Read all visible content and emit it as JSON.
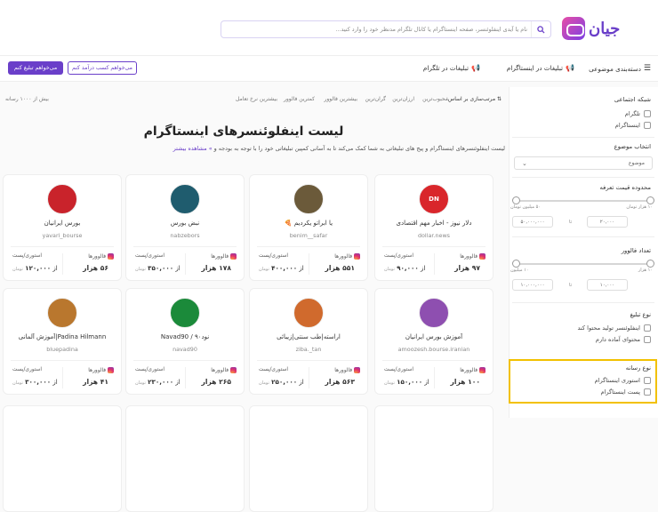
{
  "header": {
    "search_placeholder": "نام یا آیدی اینفلوئنسر، صفحه اینستاگرام یا کانال تلگرام مدنظر خود را وارد کنید...",
    "logo_text": "جیان"
  },
  "nav": {
    "categories": "دسته‌بندی موضوعی",
    "instagram_ads": "تبلیغات در اینستاگرام",
    "telegram_ads": "تبلیغات در تلگرام",
    "btn_advertise": "می‌خواهم تبلیغ کنم",
    "btn_earn": "می‌خواهم کسب درآمد کنم"
  },
  "sort": {
    "label": "مرتب‌سازی بر اساس:",
    "options": [
      "محبوب‌ترین",
      "ارزان‌ترین",
      "گران‌ترین",
      "بیشترین فالوور",
      "کمترین فالوور",
      "بیشترین نرخ تعامل"
    ],
    "count": "بیش از ۱۰۰۰ رسانه"
  },
  "page": {
    "title": "لیست اینفلوئنسرهای اینستاگرام",
    "desc": "لیست اینفلوئنسرهای اینستاگرام و پیج های تبلیغاتی به شما کمک می‌کند تا به آسانی کمپین تبلیغاتی خود را با توجه به بودجه و",
    "more": "» مشاهده بیشتر"
  },
  "sidebar": {
    "network_title": "شبکه اجتماعی",
    "networks": [
      "تلگرام",
      "اینستاگرام"
    ],
    "topic_title": "انتخاب موضوع",
    "topic_select": "موضوع",
    "price_title": "محدوده قیمت تعرفه",
    "price_min_lbl": "۱۰ هزار تومان",
    "price_max_lbl": "۵۰ میلیون تومان",
    "price_from": "۲۰,۰۰۰",
    "price_to": "۵۰,۰۰۰,۰۰۰",
    "to_word": "تا",
    "followers_title": "تعداد فالوور",
    "fol_min_lbl": "۱۰ هزار",
    "fol_max_lbl": "۱۰ میلیون",
    "fol_from": "۱۰,۰۰۰",
    "fol_to": "۱۰,۰۰۰,۰۰۰",
    "ad_type_title": "نوع تبلیغ",
    "ad_types": [
      "اینفلوئنسر تولید محتوا کند",
      "محتوای آماده دارم"
    ],
    "media_title": "نوع رسانه",
    "media_types": [
      "استوری اینستاگرام",
      "پست اینستاگرام"
    ]
  },
  "labels": {
    "followers": "فالوورها",
    "story_post": "استوری/پست",
    "from": "از",
    "toman": "تومان"
  },
  "cards": [
    {
      "name": "دلار نیوز - اخبار مهم اقتصادی",
      "user": "dollar.news",
      "followers": "۹۷ هزار",
      "price": "۹۰,۰۰۰",
      "avatar": "DN",
      "color": "#d9262b"
    },
    {
      "name": "یا ابراتو یکردیم 🍕",
      "user": "benim__safar",
      "followers": "۵۵۱ هزار",
      "price": "۴۰۰,۰۰۰",
      "avatar": "",
      "color": "#6b5a3a"
    },
    {
      "name": "نبض بورس",
      "user": "nabzebors",
      "followers": "۱۷۸ هزار",
      "price": "۳۵۰,۰۰۰",
      "avatar": "",
      "color": "#1f5c6e"
    },
    {
      "name": "بورس ایرانیان",
      "user": "yavari_bourse",
      "followers": "۵۶ هزار",
      "price": "۱۲۰,۰۰۰",
      "avatar": "",
      "color": "#c9232b"
    },
    {
      "name": "آموزش بورس ایرانیان",
      "user": "amoozesh.bourse.iranian",
      "followers": "۱۰۰ هزار",
      "price": "۱۵۰,۰۰۰",
      "avatar": "",
      "color": "#8e4fb0"
    },
    {
      "name": "اراسته|طب سنتی|زیبائی",
      "user": "ziba._tan",
      "followers": "۵۶۳ هزار",
      "price": "۲۵۰,۰۰۰",
      "avatar": "",
      "color": "#d06a2d"
    },
    {
      "name": "نود۹۰ / Navad90",
      "user": "navad90",
      "followers": "۲۶۵ هزار",
      "price": "۲۳۰,۰۰۰",
      "avatar": "",
      "color": "#1b8a3a"
    },
    {
      "name": "Padina Hilmann|آموزش آلمانی",
      "user": "bluepadina",
      "followers": "۴۱ هزار",
      "price": "۳۰۰,۰۰۰",
      "avatar": "",
      "color": "#b9772e"
    }
  ]
}
